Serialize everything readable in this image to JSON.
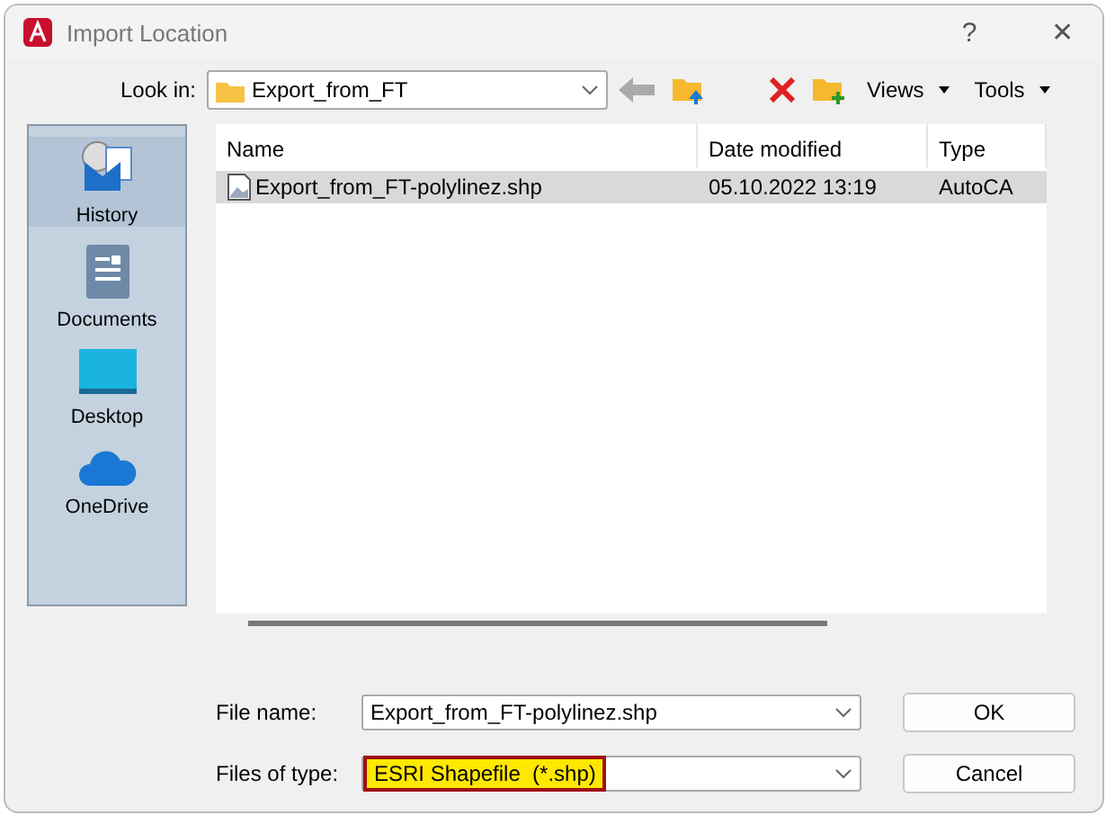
{
  "window": {
    "title": "Import Location",
    "help": "?",
    "close": "✕"
  },
  "look_in": {
    "label": "Look in:",
    "value": "Export_from_FT"
  },
  "toolbar": {
    "views": "Views",
    "tools": "Tools"
  },
  "sidebar": {
    "items": [
      {
        "label": "History",
        "kind": "history",
        "selected": true
      },
      {
        "label": "Documents",
        "kind": "documents",
        "selected": false
      },
      {
        "label": "Desktop",
        "kind": "desktop",
        "selected": false
      },
      {
        "label": "OneDrive",
        "kind": "cloud",
        "selected": false
      }
    ]
  },
  "table": {
    "columns": [
      "Name",
      "Date modified",
      "Type"
    ],
    "rows": [
      {
        "cells": [
          "Export_from_FT-polylinez.shp",
          "05.10.2022 13:19",
          "AutoCA"
        ],
        "selected": true
      }
    ]
  },
  "file_name": {
    "label": "File name:",
    "value": "Export_from_FT-polylinez.shp"
  },
  "file_type": {
    "label": "Files of type:",
    "value": "ESRI Shapefile  (*.shp)",
    "highlighted": true
  },
  "buttons": [
    "OK",
    "Cancel"
  ]
}
